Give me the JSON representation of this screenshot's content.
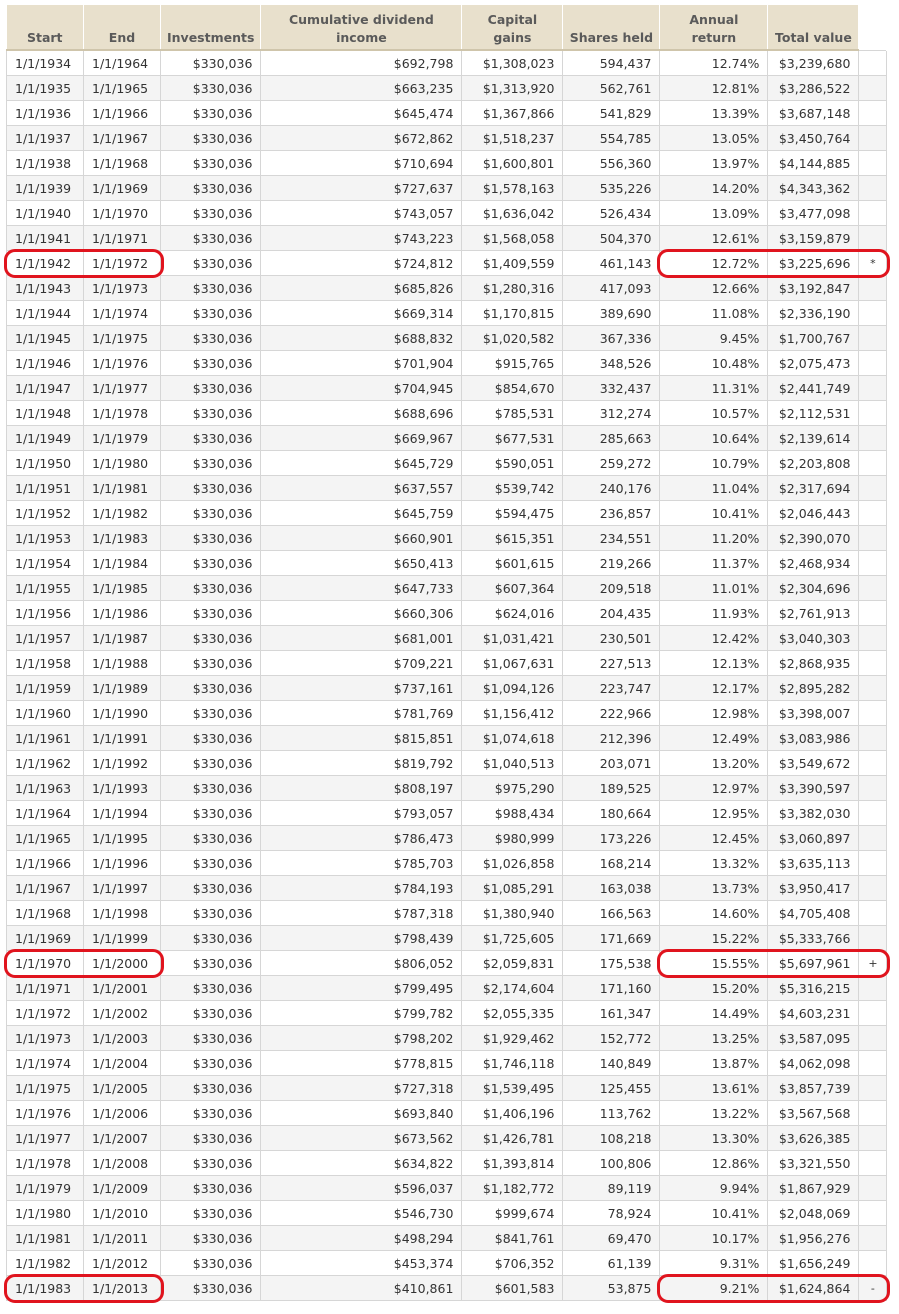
{
  "columns": [
    "Start",
    "End",
    "Investments",
    "Cumulative dividend income",
    "Capital gains",
    "Shares held",
    "Annual return",
    "Total value",
    ""
  ],
  "rows": [
    {
      "start": "1/1/1934",
      "end": "1/1/1964",
      "inv": "$330,036",
      "div": "$692,798",
      "cap": "$1,308,023",
      "shares": "594,437",
      "ret": "12.74%",
      "total": "$3,239,680",
      "mark": ""
    },
    {
      "start": "1/1/1935",
      "end": "1/1/1965",
      "inv": "$330,036",
      "div": "$663,235",
      "cap": "$1,313,920",
      "shares": "562,761",
      "ret": "12.81%",
      "total": "$3,286,522",
      "mark": ""
    },
    {
      "start": "1/1/1936",
      "end": "1/1/1966",
      "inv": "$330,036",
      "div": "$645,474",
      "cap": "$1,367,866",
      "shares": "541,829",
      "ret": "13.39%",
      "total": "$3,687,148",
      "mark": ""
    },
    {
      "start": "1/1/1937",
      "end": "1/1/1967",
      "inv": "$330,036",
      "div": "$672,862",
      "cap": "$1,518,237",
      "shares": "554,785",
      "ret": "13.05%",
      "total": "$3,450,764",
      "mark": ""
    },
    {
      "start": "1/1/1938",
      "end": "1/1/1968",
      "inv": "$330,036",
      "div": "$710,694",
      "cap": "$1,600,801",
      "shares": "556,360",
      "ret": "13.97%",
      "total": "$4,144,885",
      "mark": ""
    },
    {
      "start": "1/1/1939",
      "end": "1/1/1969",
      "inv": "$330,036",
      "div": "$727,637",
      "cap": "$1,578,163",
      "shares": "535,226",
      "ret": "14.20%",
      "total": "$4,343,362",
      "mark": ""
    },
    {
      "start": "1/1/1940",
      "end": "1/1/1970",
      "inv": "$330,036",
      "div": "$743,057",
      "cap": "$1,636,042",
      "shares": "526,434",
      "ret": "13.09%",
      "total": "$3,477,098",
      "mark": ""
    },
    {
      "start": "1/1/1941",
      "end": "1/1/1971",
      "inv": "$330,036",
      "div": "$743,223",
      "cap": "$1,568,058",
      "shares": "504,370",
      "ret": "12.61%",
      "total": "$3,159,879",
      "mark": ""
    },
    {
      "start": "1/1/1942",
      "end": "1/1/1972",
      "inv": "$330,036",
      "div": "$724,812",
      "cap": "$1,409,559",
      "shares": "461,143",
      "ret": "12.72%",
      "total": "$3,225,696",
      "mark": "*"
    },
    {
      "start": "1/1/1943",
      "end": "1/1/1973",
      "inv": "$330,036",
      "div": "$685,826",
      "cap": "$1,280,316",
      "shares": "417,093",
      "ret": "12.66%",
      "total": "$3,192,847",
      "mark": ""
    },
    {
      "start": "1/1/1944",
      "end": "1/1/1974",
      "inv": "$330,036",
      "div": "$669,314",
      "cap": "$1,170,815",
      "shares": "389,690",
      "ret": "11.08%",
      "total": "$2,336,190",
      "mark": ""
    },
    {
      "start": "1/1/1945",
      "end": "1/1/1975",
      "inv": "$330,036",
      "div": "$688,832",
      "cap": "$1,020,582",
      "shares": "367,336",
      "ret": "9.45%",
      "total": "$1,700,767",
      "mark": ""
    },
    {
      "start": "1/1/1946",
      "end": "1/1/1976",
      "inv": "$330,036",
      "div": "$701,904",
      "cap": "$915,765",
      "shares": "348,526",
      "ret": "10.48%",
      "total": "$2,075,473",
      "mark": ""
    },
    {
      "start": "1/1/1947",
      "end": "1/1/1977",
      "inv": "$330,036",
      "div": "$704,945",
      "cap": "$854,670",
      "shares": "332,437",
      "ret": "11.31%",
      "total": "$2,441,749",
      "mark": ""
    },
    {
      "start": "1/1/1948",
      "end": "1/1/1978",
      "inv": "$330,036",
      "div": "$688,696",
      "cap": "$785,531",
      "shares": "312,274",
      "ret": "10.57%",
      "total": "$2,112,531",
      "mark": ""
    },
    {
      "start": "1/1/1949",
      "end": "1/1/1979",
      "inv": "$330,036",
      "div": "$669,967",
      "cap": "$677,531",
      "shares": "285,663",
      "ret": "10.64%",
      "total": "$2,139,614",
      "mark": ""
    },
    {
      "start": "1/1/1950",
      "end": "1/1/1980",
      "inv": "$330,036",
      "div": "$645,729",
      "cap": "$590,051",
      "shares": "259,272",
      "ret": "10.79%",
      "total": "$2,203,808",
      "mark": ""
    },
    {
      "start": "1/1/1951",
      "end": "1/1/1981",
      "inv": "$330,036",
      "div": "$637,557",
      "cap": "$539,742",
      "shares": "240,176",
      "ret": "11.04%",
      "total": "$2,317,694",
      "mark": ""
    },
    {
      "start": "1/1/1952",
      "end": "1/1/1982",
      "inv": "$330,036",
      "div": "$645,759",
      "cap": "$594,475",
      "shares": "236,857",
      "ret": "10.41%",
      "total": "$2,046,443",
      "mark": ""
    },
    {
      "start": "1/1/1953",
      "end": "1/1/1983",
      "inv": "$330,036",
      "div": "$660,901",
      "cap": "$615,351",
      "shares": "234,551",
      "ret": "11.20%",
      "total": "$2,390,070",
      "mark": ""
    },
    {
      "start": "1/1/1954",
      "end": "1/1/1984",
      "inv": "$330,036",
      "div": "$650,413",
      "cap": "$601,615",
      "shares": "219,266",
      "ret": "11.37%",
      "total": "$2,468,934",
      "mark": ""
    },
    {
      "start": "1/1/1955",
      "end": "1/1/1985",
      "inv": "$330,036",
      "div": "$647,733",
      "cap": "$607,364",
      "shares": "209,518",
      "ret": "11.01%",
      "total": "$2,304,696",
      "mark": ""
    },
    {
      "start": "1/1/1956",
      "end": "1/1/1986",
      "inv": "$330,036",
      "div": "$660,306",
      "cap": "$624,016",
      "shares": "204,435",
      "ret": "11.93%",
      "total": "$2,761,913",
      "mark": ""
    },
    {
      "start": "1/1/1957",
      "end": "1/1/1987",
      "inv": "$330,036",
      "div": "$681,001",
      "cap": "$1,031,421",
      "shares": "230,501",
      "ret": "12.42%",
      "total": "$3,040,303",
      "mark": ""
    },
    {
      "start": "1/1/1958",
      "end": "1/1/1988",
      "inv": "$330,036",
      "div": "$709,221",
      "cap": "$1,067,631",
      "shares": "227,513",
      "ret": "12.13%",
      "total": "$2,868,935",
      "mark": ""
    },
    {
      "start": "1/1/1959",
      "end": "1/1/1989",
      "inv": "$330,036",
      "div": "$737,161",
      "cap": "$1,094,126",
      "shares": "223,747",
      "ret": "12.17%",
      "total": "$2,895,282",
      "mark": ""
    },
    {
      "start": "1/1/1960",
      "end": "1/1/1990",
      "inv": "$330,036",
      "div": "$781,769",
      "cap": "$1,156,412",
      "shares": "222,966",
      "ret": "12.98%",
      "total": "$3,398,007",
      "mark": ""
    },
    {
      "start": "1/1/1961",
      "end": "1/1/1991",
      "inv": "$330,036",
      "div": "$815,851",
      "cap": "$1,074,618",
      "shares": "212,396",
      "ret": "12.49%",
      "total": "$3,083,986",
      "mark": ""
    },
    {
      "start": "1/1/1962",
      "end": "1/1/1992",
      "inv": "$330,036",
      "div": "$819,792",
      "cap": "$1,040,513",
      "shares": "203,071",
      "ret": "13.20%",
      "total": "$3,549,672",
      "mark": ""
    },
    {
      "start": "1/1/1963",
      "end": "1/1/1993",
      "inv": "$330,036",
      "div": "$808,197",
      "cap": "$975,290",
      "shares": "189,525",
      "ret": "12.97%",
      "total": "$3,390,597",
      "mark": ""
    },
    {
      "start": "1/1/1964",
      "end": "1/1/1994",
      "inv": "$330,036",
      "div": "$793,057",
      "cap": "$988,434",
      "shares": "180,664",
      "ret": "12.95%",
      "total": "$3,382,030",
      "mark": ""
    },
    {
      "start": "1/1/1965",
      "end": "1/1/1995",
      "inv": "$330,036",
      "div": "$786,473",
      "cap": "$980,999",
      "shares": "173,226",
      "ret": "12.45%",
      "total": "$3,060,897",
      "mark": ""
    },
    {
      "start": "1/1/1966",
      "end": "1/1/1996",
      "inv": "$330,036",
      "div": "$785,703",
      "cap": "$1,026,858",
      "shares": "168,214",
      "ret": "13.32%",
      "total": "$3,635,113",
      "mark": ""
    },
    {
      "start": "1/1/1967",
      "end": "1/1/1997",
      "inv": "$330,036",
      "div": "$784,193",
      "cap": "$1,085,291",
      "shares": "163,038",
      "ret": "13.73%",
      "total": "$3,950,417",
      "mark": ""
    },
    {
      "start": "1/1/1968",
      "end": "1/1/1998",
      "inv": "$330,036",
      "div": "$787,318",
      "cap": "$1,380,940",
      "shares": "166,563",
      "ret": "14.60%",
      "total": "$4,705,408",
      "mark": ""
    },
    {
      "start": "1/1/1969",
      "end": "1/1/1999",
      "inv": "$330,036",
      "div": "$798,439",
      "cap": "$1,725,605",
      "shares": "171,669",
      "ret": "15.22%",
      "total": "$5,333,766",
      "mark": ""
    },
    {
      "start": "1/1/1970",
      "end": "1/1/2000",
      "inv": "$330,036",
      "div": "$806,052",
      "cap": "$2,059,831",
      "shares": "175,538",
      "ret": "15.55%",
      "total": "$5,697,961",
      "mark": "+"
    },
    {
      "start": "1/1/1971",
      "end": "1/1/2001",
      "inv": "$330,036",
      "div": "$799,495",
      "cap": "$2,174,604",
      "shares": "171,160",
      "ret": "15.20%",
      "total": "$5,316,215",
      "mark": ""
    },
    {
      "start": "1/1/1972",
      "end": "1/1/2002",
      "inv": "$330,036",
      "div": "$799,782",
      "cap": "$2,055,335",
      "shares": "161,347",
      "ret": "14.49%",
      "total": "$4,603,231",
      "mark": ""
    },
    {
      "start": "1/1/1973",
      "end": "1/1/2003",
      "inv": "$330,036",
      "div": "$798,202",
      "cap": "$1,929,462",
      "shares": "152,772",
      "ret": "13.25%",
      "total": "$3,587,095",
      "mark": ""
    },
    {
      "start": "1/1/1974",
      "end": "1/1/2004",
      "inv": "$330,036",
      "div": "$778,815",
      "cap": "$1,746,118",
      "shares": "140,849",
      "ret": "13.87%",
      "total": "$4,062,098",
      "mark": ""
    },
    {
      "start": "1/1/1975",
      "end": "1/1/2005",
      "inv": "$330,036",
      "div": "$727,318",
      "cap": "$1,539,495",
      "shares": "125,455",
      "ret": "13.61%",
      "total": "$3,857,739",
      "mark": ""
    },
    {
      "start": "1/1/1976",
      "end": "1/1/2006",
      "inv": "$330,036",
      "div": "$693,840",
      "cap": "$1,406,196",
      "shares": "113,762",
      "ret": "13.22%",
      "total": "$3,567,568",
      "mark": ""
    },
    {
      "start": "1/1/1977",
      "end": "1/1/2007",
      "inv": "$330,036",
      "div": "$673,562",
      "cap": "$1,426,781",
      "shares": "108,218",
      "ret": "13.30%",
      "total": "$3,626,385",
      "mark": ""
    },
    {
      "start": "1/1/1978",
      "end": "1/1/2008",
      "inv": "$330,036",
      "div": "$634,822",
      "cap": "$1,393,814",
      "shares": "100,806",
      "ret": "12.86%",
      "total": "$3,321,550",
      "mark": ""
    },
    {
      "start": "1/1/1979",
      "end": "1/1/2009",
      "inv": "$330,036",
      "div": "$596,037",
      "cap": "$1,182,772",
      "shares": "89,119",
      "ret": "9.94%",
      "total": "$1,867,929",
      "mark": ""
    },
    {
      "start": "1/1/1980",
      "end": "1/1/2010",
      "inv": "$330,036",
      "div": "$546,730",
      "cap": "$999,674",
      "shares": "78,924",
      "ret": "10.41%",
      "total": "$2,048,069",
      "mark": ""
    },
    {
      "start": "1/1/1981",
      "end": "1/1/2011",
      "inv": "$330,036",
      "div": "$498,294",
      "cap": "$841,761",
      "shares": "69,470",
      "ret": "10.17%",
      "total": "$1,956,276",
      "mark": ""
    },
    {
      "start": "1/1/1982",
      "end": "1/1/2012",
      "inv": "$330,036",
      "div": "$453,374",
      "cap": "$706,352",
      "shares": "61,139",
      "ret": "9.31%",
      "total": "$1,656,249",
      "mark": ""
    },
    {
      "start": "1/1/1983",
      "end": "1/1/2013",
      "inv": "$330,036",
      "div": "$410,861",
      "cap": "$601,583",
      "shares": "53,875",
      "ret": "9.21%",
      "total": "$1,624,864",
      "mark": "-"
    }
  ],
  "highlighted_rows": [
    8,
    36,
    49
  ],
  "colors": {
    "header_bg": "#e8e0cc",
    "highlight_ring": "#e0141e",
    "alt_row": "#f4f4f4"
  }
}
